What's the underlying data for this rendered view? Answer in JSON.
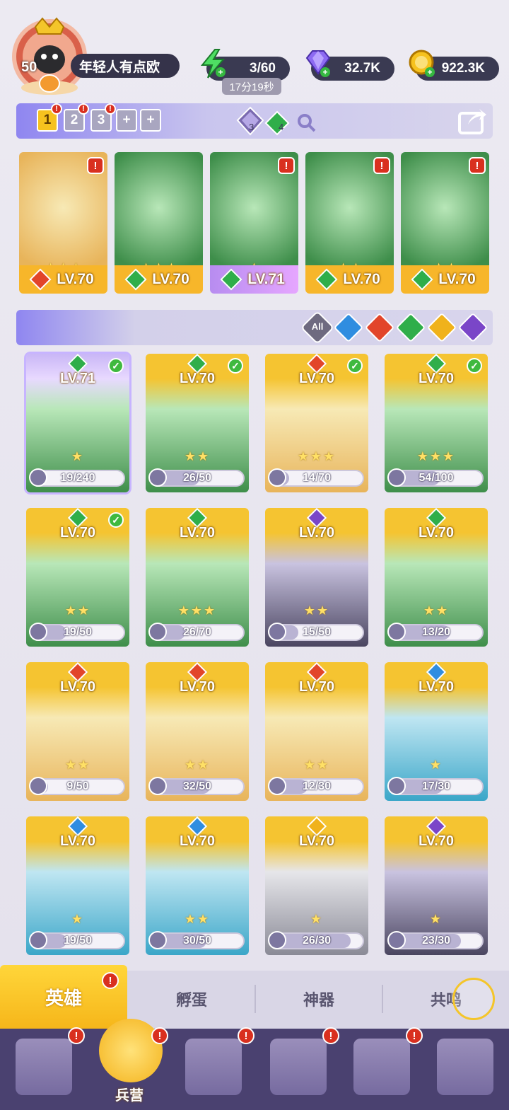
{
  "player": {
    "level": "50",
    "name": "年轻人有点欧"
  },
  "resources": {
    "energy": "3/60",
    "energy_timer": "17分19秒",
    "gems": "32.7K",
    "gold": "922.3K"
  },
  "teams": {
    "slots": [
      {
        "label": "1",
        "active": true,
        "alert": true
      },
      {
        "label": "2",
        "active": false,
        "alert": true
      },
      {
        "label": "3",
        "active": false,
        "alert": true
      },
      {
        "label": "+",
        "active": false,
        "alert": false
      },
      {
        "label": "+",
        "active": false,
        "alert": false
      }
    ],
    "crystal_count": "3",
    "emerald_count": "4"
  },
  "lineup": [
    {
      "level": "LV.70",
      "element": "fire",
      "stars": "★★★",
      "alert": true
    },
    {
      "level": "LV.70",
      "element": "nature",
      "stars": "★★★",
      "alert": false
    },
    {
      "level": "LV.71",
      "element": "nature",
      "stars": "★",
      "alert": true
    },
    {
      "level": "LV.70",
      "element": "nature",
      "stars": "★★",
      "alert": true
    },
    {
      "level": "LV.70",
      "element": "nature",
      "stars": "★★",
      "alert": true
    }
  ],
  "filters": {
    "all_label": "All",
    "elements": [
      "water",
      "fire",
      "nature",
      "light",
      "dark"
    ]
  },
  "heroes": [
    {
      "level": "LV.71",
      "element": "nature",
      "fragments": "19/240",
      "progress": 0.08,
      "check": true,
      "stars": "★"
    },
    {
      "level": "LV.70",
      "element": "nature",
      "fragments": "26/50",
      "progress": 0.52,
      "check": true,
      "stars": "★★"
    },
    {
      "level": "LV.70",
      "element": "fire",
      "fragments": "14/70",
      "progress": 0.2,
      "check": true,
      "stars": "★★★"
    },
    {
      "level": "LV.70",
      "element": "nature",
      "fragments": "54/100",
      "progress": 0.54,
      "check": true,
      "stars": "★★★"
    },
    {
      "level": "LV.70",
      "element": "nature",
      "fragments": "19/50",
      "progress": 0.38,
      "check": true,
      "stars": "★★"
    },
    {
      "level": "LV.70",
      "element": "nature",
      "fragments": "26/70",
      "progress": 0.37,
      "check": false,
      "stars": "★★★"
    },
    {
      "level": "LV.70",
      "element": "dark",
      "fragments": "15/50",
      "progress": 0.3,
      "check": false,
      "stars": "★★"
    },
    {
      "level": "LV.70",
      "element": "nature",
      "fragments": "13/20",
      "progress": 0.65,
      "check": false,
      "stars": "★★"
    },
    {
      "level": "LV.70",
      "element": "fire",
      "fragments": "9/50",
      "progress": 0.18,
      "check": false,
      "stars": "★★"
    },
    {
      "level": "LV.70",
      "element": "fire",
      "fragments": "32/50",
      "progress": 0.64,
      "check": false,
      "stars": "★★"
    },
    {
      "level": "LV.70",
      "element": "fire",
      "fragments": "12/30",
      "progress": 0.4,
      "check": false,
      "stars": "★★"
    },
    {
      "level": "LV.70",
      "element": "water",
      "fragments": "17/30",
      "progress": 0.57,
      "check": false,
      "stars": "★"
    },
    {
      "level": "LV.70",
      "element": "water",
      "fragments": "19/50",
      "progress": 0.38,
      "check": false,
      "stars": "★"
    },
    {
      "level": "LV.70",
      "element": "water",
      "fragments": "30/50",
      "progress": 0.6,
      "check": false,
      "stars": "★★"
    },
    {
      "level": "LV.70",
      "element": "light",
      "fragments": "26/30",
      "progress": 0.87,
      "check": false,
      "stars": "★"
    },
    {
      "level": "LV.70",
      "element": "dark",
      "fragments": "23/30",
      "progress": 0.77,
      "check": false,
      "stars": "★"
    }
  ],
  "tabs": [
    {
      "label": "英雄",
      "active": true,
      "alert": true
    },
    {
      "label": "孵蛋",
      "active": false,
      "alert": false
    },
    {
      "label": "神器",
      "active": false,
      "alert": false
    },
    {
      "label": "共鸣",
      "active": false,
      "alert": false
    }
  ],
  "nav": [
    {
      "label": "",
      "icon": "cards-icon",
      "alert": true
    },
    {
      "label": "兵营",
      "icon": "barracks-icon",
      "alert": true,
      "active": true
    },
    {
      "label": "",
      "icon": "map-icon",
      "alert": true
    },
    {
      "label": "",
      "icon": "castle-icon",
      "alert": true
    },
    {
      "label": "",
      "icon": "guild-icon",
      "alert": true
    },
    {
      "label": "",
      "icon": "banner-icon",
      "alert": false
    }
  ],
  "colors": {
    "fire": "#e2452a",
    "water": "#2f8de0",
    "nature": "#2fae4a",
    "light": "#f0b21b",
    "dark": "#7a46c8",
    "gold_card": "#f5c431",
    "alert": "#d9301f"
  }
}
